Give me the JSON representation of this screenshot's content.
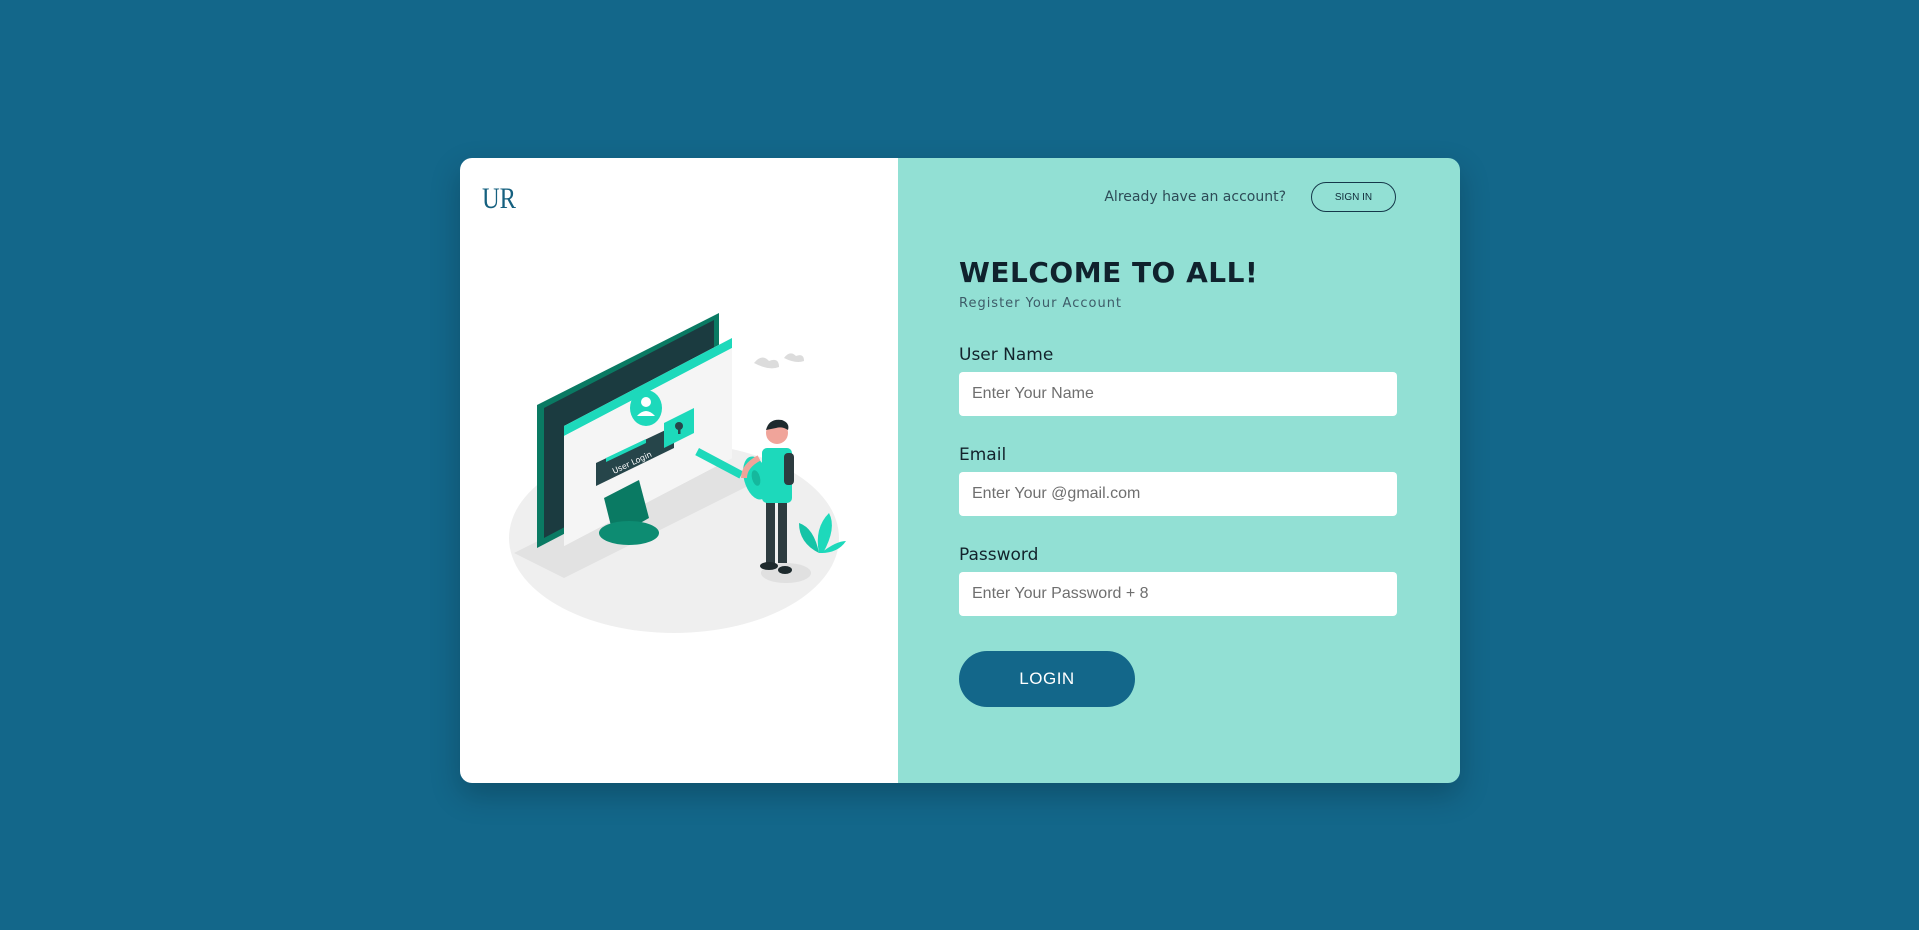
{
  "brand": {
    "logo_text": "UR",
    "primary_color": "#13678a",
    "accent_color": "#92e0d4",
    "illustration_accent": "#1dd9bb"
  },
  "illustration": {
    "screen_label": "User Login"
  },
  "header": {
    "prompt_text": "Already have an account?",
    "signin_label": "SIGN IN"
  },
  "form": {
    "title": "WELCOME TO ALL!",
    "subtitle": "Register Your Account",
    "fields": [
      {
        "label": "User Name",
        "placeholder": "Enter Your Name",
        "value": ""
      },
      {
        "label": "Email",
        "placeholder": "Enter Your @gmail.com",
        "value": ""
      },
      {
        "label": "Password",
        "placeholder": "Enter Your Password + 8",
        "value": ""
      }
    ],
    "submit_label": "LOGIN"
  }
}
